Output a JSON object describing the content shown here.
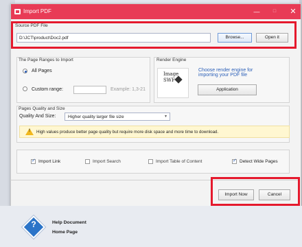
{
  "window": {
    "title": "Import PDF",
    "minimize": "—",
    "maximize": "□",
    "close": "✕"
  },
  "source": {
    "label": "Source PDF File",
    "path": "D:\\JCT\\product\\Doc2.pdf",
    "browse": "Browse...",
    "open": "Open it"
  },
  "ranges": {
    "label": "The Page Ranges to Import",
    "all_pages": "All Pages",
    "custom_range": "Custom range:",
    "custom_value": "",
    "example": "Example: 1,3-21"
  },
  "engine": {
    "label": "Render Engine",
    "icon_line1": "Image",
    "icon_line2": "SWF",
    "description_line1": "Choose render engine for",
    "description_line2": "importing your PDF file",
    "application_button": "Application"
  },
  "quality": {
    "label": "Pages Quality and Size",
    "field_label": "Quality And Size:",
    "selected": "Higher quality larger file size",
    "warning": "High values produce better page quality but require more disk space and more time to download."
  },
  "options": [
    {
      "label": "Import Link",
      "checked": true
    },
    {
      "label": "Import Search",
      "checked": false
    },
    {
      "label": "Import Table of Content",
      "checked": false
    },
    {
      "label": "Detect Wide Pages",
      "checked": true
    }
  ],
  "actions": {
    "import_now": "Import Now",
    "cancel": "Cancel"
  },
  "help": {
    "item1": "Help Document",
    "item2": "Home Page"
  }
}
